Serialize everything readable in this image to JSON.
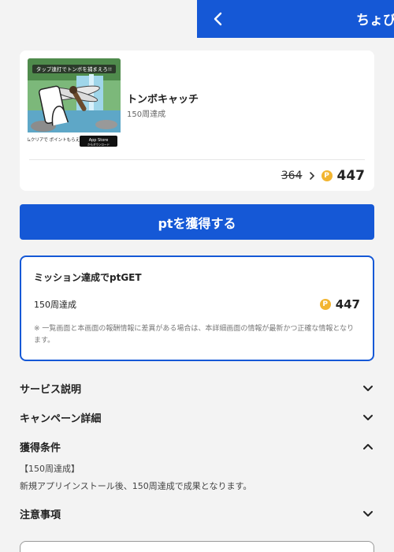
{
  "header": {
    "title": "ちょび"
  },
  "offer": {
    "banner_top_text": "タップ連打でトンボを捕まえろ!!",
    "banner_bottom_text": "ゲームクリアで ポイントもらえる?!",
    "store_badge": "App Store",
    "store_badge_sub": "からダウンロード",
    "app_name": "トンボキャッチ",
    "subtitle": "150周達成",
    "old_points": "364",
    "new_points": "447",
    "coin_symbol": "P"
  },
  "cta": {
    "label": "ptを獲得する"
  },
  "mission": {
    "title": "ミッション達成でptGET",
    "row_label": "150周達成",
    "row_points": "447",
    "coin_symbol": "P",
    "note": "※ 一覧画面と本画面の報酬情報に差異がある場合は、本詳細画面の情報が最新かつ正確な情報となります。"
  },
  "sections": {
    "service": "サービス説明",
    "campaign": "キャンペーン詳細",
    "conditions": "獲得条件",
    "notes": "注意事項"
  },
  "conditions": {
    "line1": "【150周達成】",
    "line2": "新規アプリインストール後、150周達成で成果となります。"
  },
  "colors": {
    "brand": "#1558d6",
    "coin": "#f2b531"
  }
}
